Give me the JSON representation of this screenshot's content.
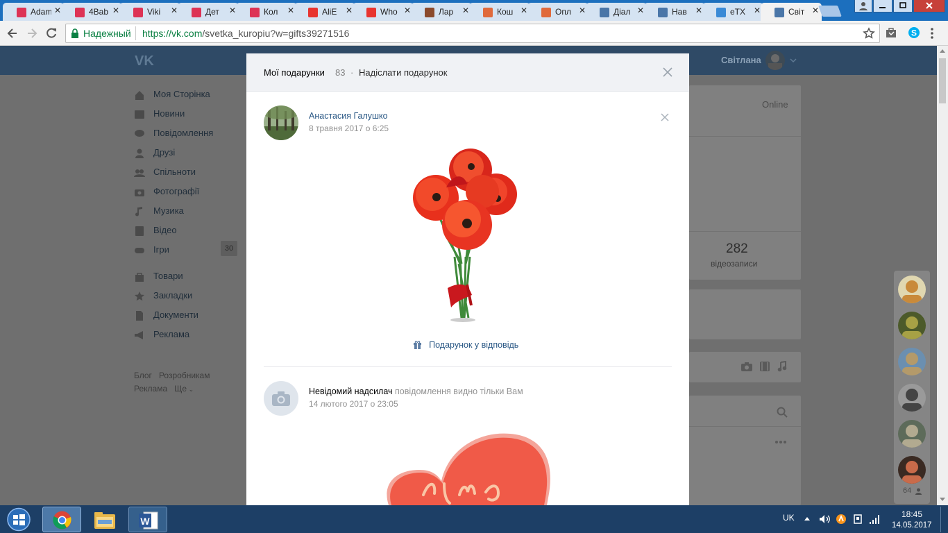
{
  "browser": {
    "tabs": [
      {
        "title": "Adam",
        "fav": "stroller-icon",
        "color": "#d35"
      },
      {
        "title": "4Bab",
        "fav": "stroller-icon",
        "color": "#d35"
      },
      {
        "title": "Viki",
        "fav": "stroller-icon",
        "color": "#d35"
      },
      {
        "title": "Дет",
        "fav": "stroller-icon",
        "color": "#d35"
      },
      {
        "title": "Кол",
        "fav": "stroller-icon",
        "color": "#d35"
      },
      {
        "title": "AliE",
        "fav": "pocket-icon",
        "color": "#e8342f"
      },
      {
        "title": "Who",
        "fav": "pocket-icon",
        "color": "#e8342f"
      },
      {
        "title": "Лар",
        "fav": "doc-icon",
        "color": "#8b4a2c"
      },
      {
        "title": "Кош",
        "fav": "pinwheel-icon",
        "color": "#e06a3c"
      },
      {
        "title": "Опл",
        "fav": "pinwheel-icon",
        "color": "#e06a3c"
      },
      {
        "title": "Діал",
        "fav": "chat-icon",
        "color": "#4a76a8"
      },
      {
        "title": "Нав",
        "fav": "vk-icon",
        "color": "#4a76a8"
      },
      {
        "title": "eTX",
        "fav": "edit-icon",
        "color": "#3a8ad6"
      },
      {
        "title": "Світ",
        "fav": "vk-icon",
        "color": "#4a76a8",
        "active": true
      }
    ],
    "secure_label": "Надежный",
    "url_host": "https://vk.com",
    "url_path": "/svetka_kuropiu?w=gifts39271516"
  },
  "vk": {
    "user_name": "Світлана",
    "nav": [
      {
        "label": "Моя Сторінка",
        "icon": "home-icon"
      },
      {
        "label": "Новини",
        "icon": "news-icon"
      },
      {
        "label": "Повідомлення",
        "icon": "message-icon"
      },
      {
        "label": "Друзі",
        "icon": "user-icon"
      },
      {
        "label": "Спільноти",
        "icon": "group-icon"
      },
      {
        "label": "Фотографії",
        "icon": "camera-icon"
      },
      {
        "label": "Музика",
        "icon": "music-icon"
      },
      {
        "label": "Відео",
        "icon": "video-icon"
      },
      {
        "label": "Ігри",
        "icon": "gamepad-icon",
        "badge": "30"
      }
    ],
    "nav2": [
      {
        "label": "Товари",
        "icon": "bag-icon"
      },
      {
        "label": "Закладки",
        "icon": "star-icon"
      },
      {
        "label": "Документи",
        "icon": "document-icon"
      },
      {
        "label": "Реклама",
        "icon": "megaphone-icon"
      }
    ],
    "footer": {
      "blog": "Блог",
      "dev": "Розробникам",
      "ads": "Реклама",
      "more": "Ще"
    },
    "profile": {
      "online": "Online",
      "videos_count": "282",
      "videos_label": "відеозаписи"
    },
    "friends_count": "64"
  },
  "modal": {
    "title": "Мої подарунки",
    "count": "83",
    "sep": "·",
    "send_label": "Надіслати подарунок",
    "gifts": [
      {
        "sender": "Анастасия Галушко",
        "date": "8 травня 2017 о 6:25",
        "reply": "Подарунок у відповідь"
      },
      {
        "sender": "Невідомий надсилач",
        "note": "повідомлення видно тільки Вам",
        "date": "14 лютого 2017 о 23:05"
      }
    ]
  },
  "taskbar": {
    "lang": "UK",
    "time": "18:45",
    "date": "14.05.2017"
  }
}
